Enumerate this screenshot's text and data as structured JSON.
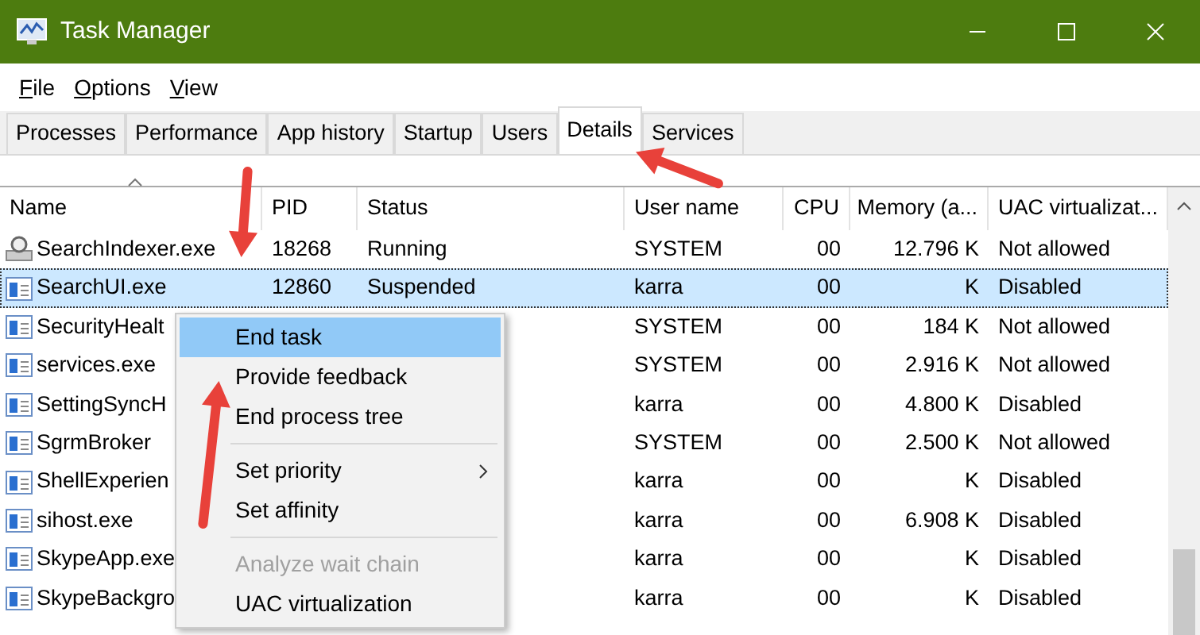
{
  "window": {
    "title": "Task Manager"
  },
  "menu_bar": [
    "File",
    "Options",
    "View"
  ],
  "tabs": [
    {
      "label": "Processes",
      "selected": false
    },
    {
      "label": "Performance",
      "selected": false
    },
    {
      "label": "App history",
      "selected": false
    },
    {
      "label": "Startup",
      "selected": false
    },
    {
      "label": "Users",
      "selected": false
    },
    {
      "label": "Details",
      "selected": true
    },
    {
      "label": "Services",
      "selected": false
    }
  ],
  "table": {
    "columns": [
      {
        "label": "Name",
        "sorted": true
      },
      {
        "label": "PID",
        "sorted": false
      },
      {
        "label": "Status",
        "sorted": false
      },
      {
        "label": "User name",
        "sorted": false
      },
      {
        "label": "CPU",
        "sorted": false
      },
      {
        "label": "Memory (a...",
        "sorted": false
      },
      {
        "label": "UAC virtualizat...",
        "sorted": false
      }
    ],
    "rows": [
      {
        "kind": "search",
        "name": "SearchIndexer.exe",
        "pid": "18268",
        "status": "Running",
        "user": "SYSTEM",
        "cpu": "00",
        "memory": "12.796 K",
        "uac": "Not allowed",
        "selected": false
      },
      {
        "kind": "window",
        "name": "SearchUI.exe",
        "pid": "12860",
        "status": "Suspended",
        "user": "karra",
        "cpu": "00",
        "memory": "K",
        "uac": "Disabled",
        "selected": true
      },
      {
        "kind": "window",
        "name": "SecurityHealt",
        "user": "SYSTEM",
        "cpu": "00",
        "memory": "184 K",
        "uac": "Not allowed",
        "selected": false
      },
      {
        "kind": "window",
        "name": "services.exe",
        "user": "SYSTEM",
        "cpu": "00",
        "memory": "2.916 K",
        "uac": "Not allowed",
        "selected": false
      },
      {
        "kind": "window",
        "name": "SettingSyncH",
        "user": "karra",
        "cpu": "00",
        "memory": "4.800 K",
        "uac": "Disabled",
        "selected": false
      },
      {
        "kind": "window",
        "name": "SgrmBroker",
        "user": "SYSTEM",
        "cpu": "00",
        "memory": "2.500 K",
        "uac": "Not allowed",
        "selected": false
      },
      {
        "kind": "window",
        "name": "ShellExperien",
        "user": "karra",
        "cpu": "00",
        "memory": "K",
        "uac": "Disabled",
        "selected": false
      },
      {
        "kind": "window",
        "name": "sihost.exe",
        "user": "karra",
        "cpu": "00",
        "memory": "6.908 K",
        "uac": "Disabled",
        "selected": false
      },
      {
        "kind": "window",
        "name": "SkypeApp.exe",
        "user": "karra",
        "cpu": "00",
        "memory": "K",
        "uac": "Disabled",
        "selected": false
      },
      {
        "kind": "window",
        "name": "SkypeBackgro",
        "user": "karra",
        "cpu": "00",
        "memory": "K",
        "uac": "Disabled",
        "selected": false
      }
    ]
  },
  "context_menu": {
    "items": [
      {
        "kind": "item",
        "label": "End task",
        "selected": true,
        "disabled": false,
        "submenu": false
      },
      {
        "kind": "item",
        "label": "Provide feedback",
        "selected": false,
        "disabled": false,
        "submenu": false
      },
      {
        "kind": "item",
        "label": "End process tree",
        "selected": false,
        "disabled": false,
        "submenu": false
      },
      {
        "kind": "separator"
      },
      {
        "kind": "item",
        "label": "Set priority",
        "selected": false,
        "disabled": false,
        "submenu": true
      },
      {
        "kind": "item",
        "label": "Set affinity",
        "selected": false,
        "disabled": false,
        "submenu": false
      },
      {
        "kind": "separator"
      },
      {
        "kind": "item",
        "label": "Analyze wait chain",
        "selected": false,
        "disabled": true,
        "submenu": false
      },
      {
        "kind": "item",
        "label": "UAC virtualization",
        "selected": false,
        "disabled": false,
        "submenu": false
      }
    ]
  },
  "annotations": [
    {
      "kind": "arrow"
    },
    {
      "kind": "arrow"
    },
    {
      "kind": "arrow"
    }
  ]
}
